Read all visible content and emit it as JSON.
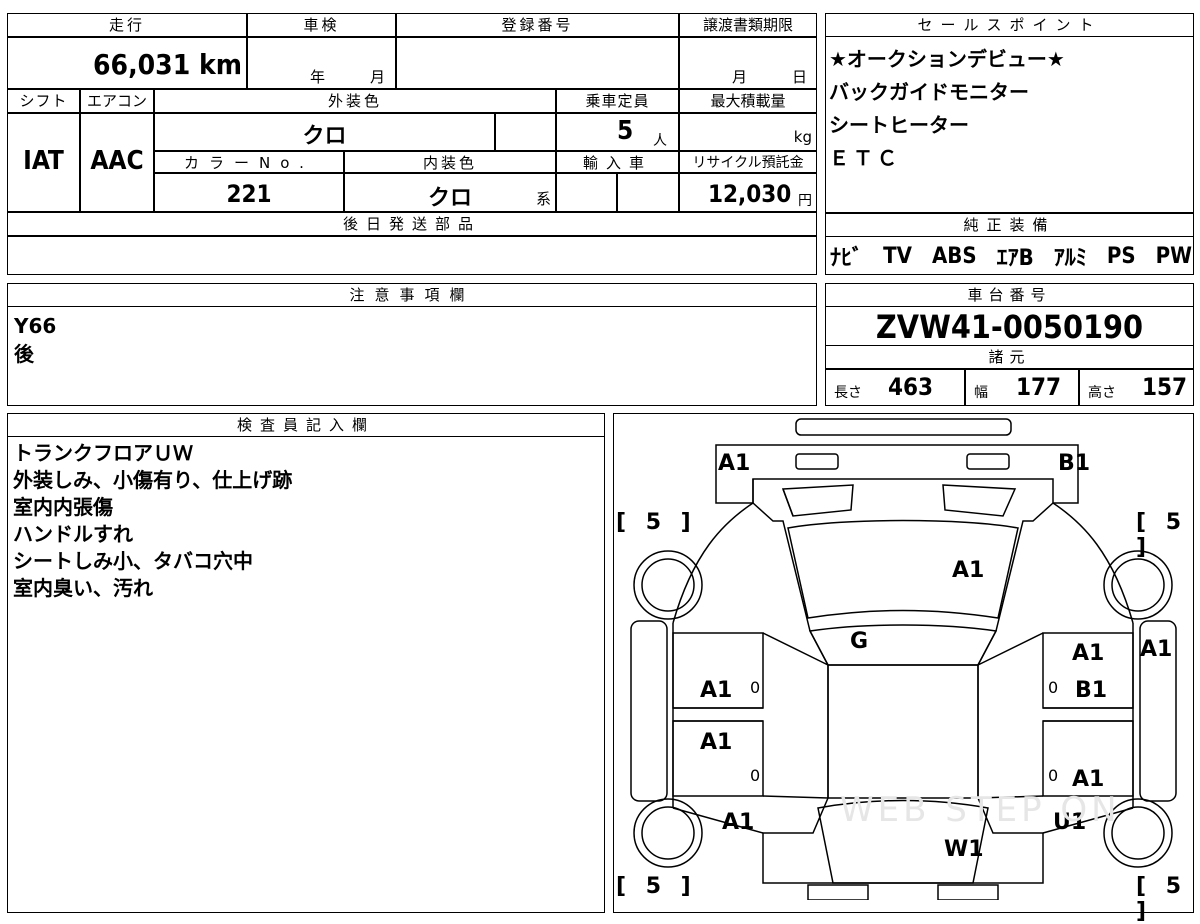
{
  "top_top": {
    "mileage_label": "走行",
    "inspection_label": "車検",
    "registration_label": "登録番号",
    "transfer_label": "譲渡書類期限"
  },
  "mileage": "66,031 km",
  "inspection": {
    "year": "年",
    "month": "月"
  },
  "transfer": {
    "month": "月",
    "day": "日"
  },
  "row2": {
    "shift_label": "シフト",
    "ac_label": "エアコン",
    "exterior_color_label": "外装色",
    "capacity_label": "乗車定員",
    "max_load_label": "最大積載量"
  },
  "shift": "IAT",
  "ac": "AAC",
  "exterior_color": "クロ",
  "capacity": "5",
  "capacity_unit": "人",
  "max_load_unit": "kg",
  "row3": {
    "color_no_label": "カラーNo.",
    "interior_color_label": "内装色",
    "import_label": "輸入車",
    "recycle_label": "リサイクル預託金"
  },
  "color_no": "221",
  "interior_color": "クロ",
  "interior_suffix": "系",
  "recycle_fee": "12,030",
  "recycle_unit": "円",
  "later_parts_label": "後日発送部品",
  "sales_points": {
    "label": "セールスポイント",
    "items": [
      "★オークションデビュー★",
      "バックガイドモニター",
      "シートヒーター",
      "ＥＴＣ"
    ]
  },
  "genuine_equipment": {
    "label": "純正装備",
    "items": [
      "ﾅﾋﾞ",
      "TV",
      "ABS",
      "ｴｱB",
      "ｱﾙﾐ",
      "PS",
      "PW"
    ]
  },
  "notes": {
    "label": "注意事項欄",
    "lines": [
      "Y66",
      "後"
    ]
  },
  "chassis": {
    "label": "車台番号",
    "number": "ZVW41-0050190"
  },
  "specs": {
    "label": "諸元",
    "length_label": "長さ",
    "length": "463",
    "width_label": "幅",
    "width": "177",
    "height_label": "高さ",
    "height": "157"
  },
  "inspector": {
    "label": "検査員記入欄",
    "lines": [
      "トランクフロアＵＷ",
      "外装しみ、小傷有り、仕上げ跡",
      "室内内張傷",
      "ハンドルすれ",
      "シートしみ小、タバコ穴中",
      "室内臭い、汚れ"
    ]
  },
  "diagram": {
    "marks": {
      "rear_left": "A1",
      "rear_right": "B1",
      "trunk": "A1",
      "rear_glass": "G",
      "right_upper": "A1",
      "right_fender": "A1",
      "left_rear_door": "A1",
      "right_rear_door": "B1",
      "left_front_door": "A1",
      "right_front_door": "A1",
      "left_front": "A1",
      "right_front": "U1",
      "windshield": "W1"
    },
    "tread": "[ 5 ]",
    "zero": "0"
  },
  "watermark": "WEB STEP ON"
}
